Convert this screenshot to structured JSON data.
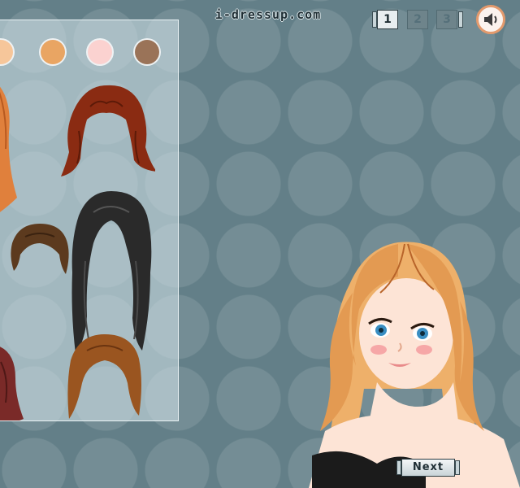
{
  "header": {
    "site_name": "i-dressup.com"
  },
  "pagination": {
    "pages": [
      "1",
      "2",
      "3"
    ],
    "current_page": "1"
  },
  "sound": {
    "icon": "speaker-icon"
  },
  "panel": {
    "skin_tones": [
      "#f6c69a",
      "#e9a563",
      "#fbd2d0",
      "#9a7358"
    ],
    "hairstyles": [
      {
        "name": "auburn-layered-hair",
        "color": "#8a2b12"
      },
      {
        "name": "black-long-hair",
        "color": "#2a2a2a"
      },
      {
        "name": "brown-short-hair",
        "color": "#5c3a1e"
      },
      {
        "name": "chestnut-bob-hair",
        "color": "#9a5520"
      },
      {
        "name": "ginger-long-hair-partial",
        "color": "#e0803c"
      },
      {
        "name": "red-curly-hair-partial",
        "color": "#7a2a28"
      }
    ]
  },
  "navigation": {
    "next_label": "Next"
  },
  "colors": {
    "background": "#637f88",
    "accent": "#e39a6d",
    "panel_border": "#eaf3f5"
  }
}
